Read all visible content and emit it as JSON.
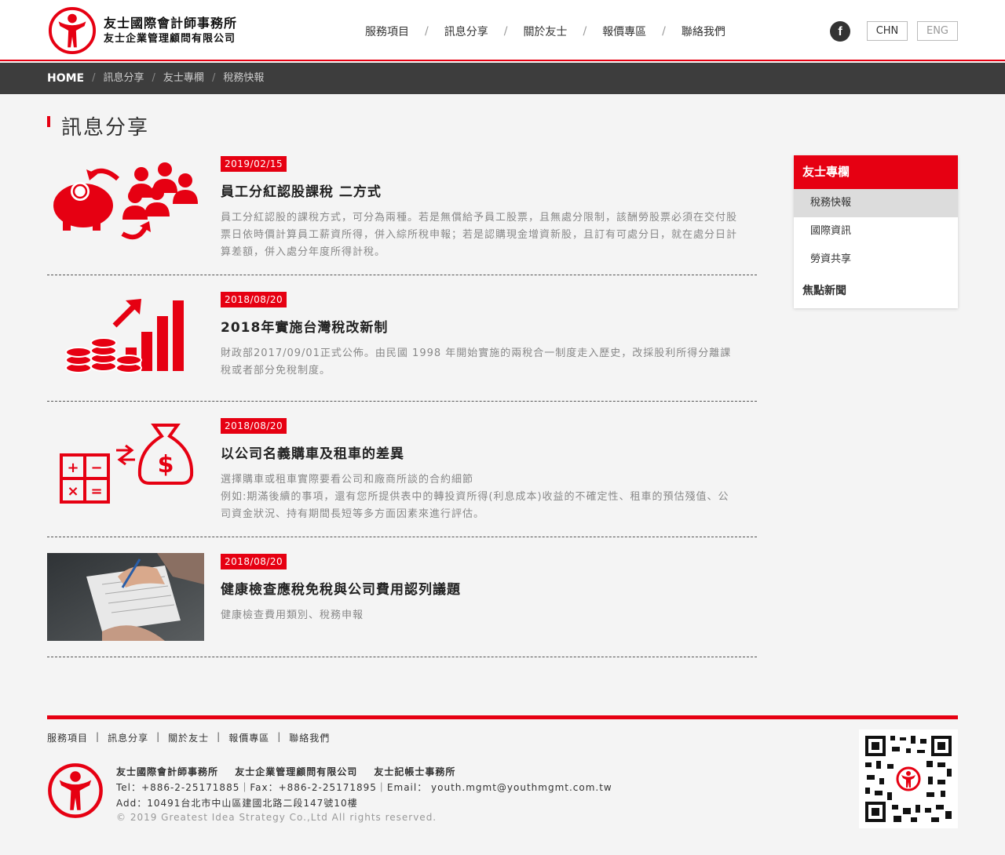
{
  "header": {
    "brand_line1": "友士國際會計師事務所",
    "brand_line2": "友士企業管理顧問有限公司",
    "nav": [
      "服務項目",
      "訊息分享",
      "關於友士",
      "報價專區",
      "聯絡我們"
    ],
    "nav_separator": "/",
    "facebook_glyph": "f",
    "lang_chn": "CHN",
    "lang_eng": "ENG"
  },
  "breadcrumb": {
    "home": "HOME",
    "separator": "/",
    "items": [
      "訊息分享",
      "友士專欄",
      "稅務快報"
    ]
  },
  "page_title": "訊息分享",
  "articles": [
    {
      "date": "2019/02/15",
      "title": "員工分紅認股課稅 二方式",
      "summary": "員工分紅認股的課稅方式，可分為兩種。若是無償給予員工股票，且無處分限制，該酬勞股票必須在交付股票日依時價計算員工薪資所得，併入綜所稅申報；若是認購現金增資新股，且訂有可處分日，就在處分日計算差額，併入處分年度所得計稅。",
      "icon": "piggy-bank-people-icon"
    },
    {
      "date": "2018/08/20",
      "title": "2018年實施台灣稅改新制",
      "summary": "財政部2017/09/01正式公佈。由民國 1998 年開始實施的兩稅合一制度走入歷史，改採股利所得分離課稅或者部分免稅制度。",
      "icon": "coins-growth-chart-icon"
    },
    {
      "date": "2018/08/20",
      "title": "以公司名義購車及租車的差異",
      "summary_line1": "選擇購車或租車實際要看公司和廠商所談的合約細節",
      "summary_line2": "例如:期滿後續的事項，還有您所提供表中的轉投資所得(利息成本)收益的不確定性、租車的預估殘值、公司資金狀況、持有期間長短等多方面因素來進行評估。",
      "icon": "calculator-money-bag-icon",
      "money_symbol": "$"
    },
    {
      "date": "2018/08/20",
      "title": "健康檢查應稅免稅與公司費用認列議題",
      "summary": "健康檢查費用類別、稅務申報",
      "icon": "person-writing-photo"
    }
  ],
  "sidebar": {
    "heading": "友士專欄",
    "items": [
      "稅務快報",
      "國際資訊",
      "勞資共享"
    ],
    "active": "稅務快報",
    "section2": "焦點新聞"
  },
  "footer": {
    "nav": [
      "服務項目",
      "訊息分享",
      "關於友士",
      "報價專區",
      "聯絡我們"
    ],
    "nav_separator": "|",
    "names": [
      "友士國際會計師事務所",
      "友士企業管理顧問有限公司",
      "友士記帳士事務所"
    ],
    "contact": "Tel：+886-2-25171885｜Fax：+886-2-25171895｜Email： youth.mgmt@youthmgmt.com.tw",
    "address": "Add：10491台北市中山區建國北路二段147號10樓",
    "copyright": "© 2019 Greatest Idea Strategy Co.,Ltd All rights reserved."
  },
  "colors": {
    "accent": "#e60012",
    "dark_bar": "#3d3d3d",
    "background": "#f4f4f4"
  }
}
